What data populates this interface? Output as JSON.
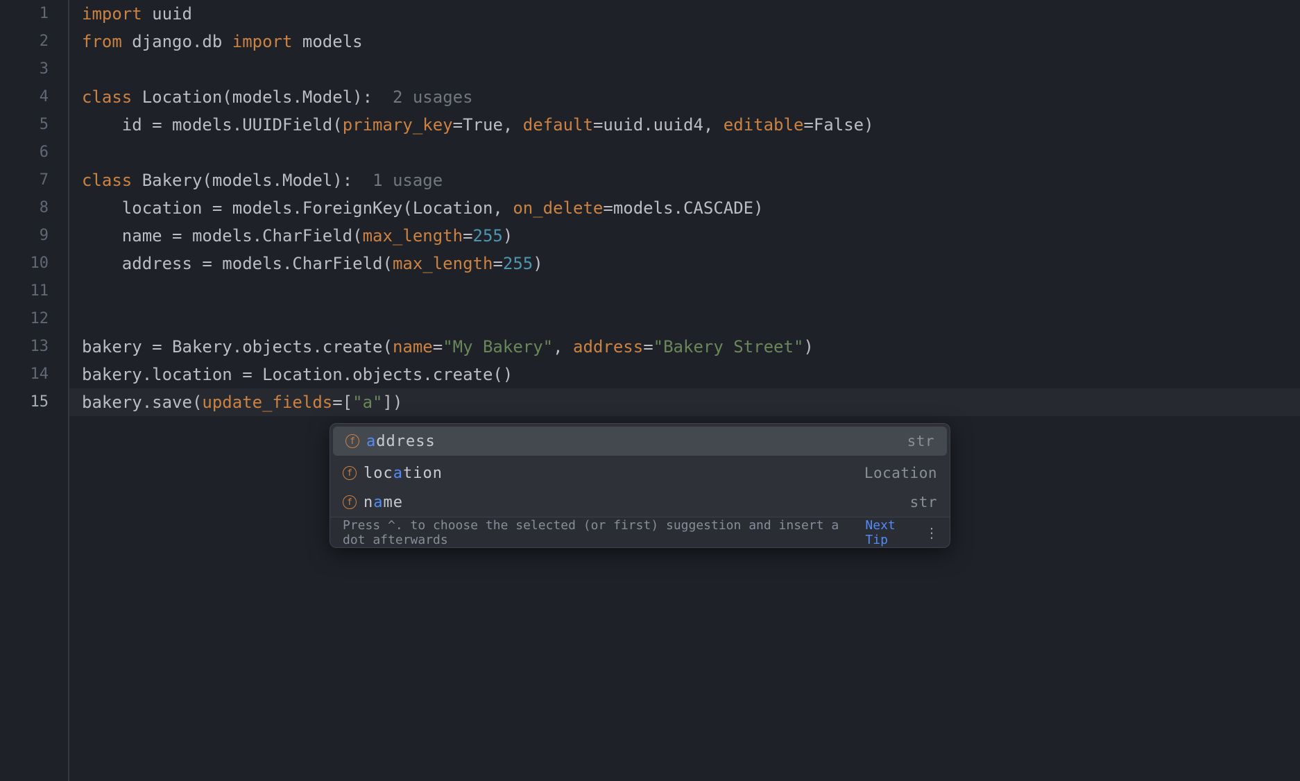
{
  "gutter": {
    "lines": [
      "1",
      "2",
      "3",
      "4",
      "5",
      "6",
      "7",
      "8",
      "9",
      "10",
      "11",
      "12",
      "13",
      "14",
      "15"
    ],
    "current": 15
  },
  "code": {
    "l1": {
      "kw1": "import",
      "mod": "uuid"
    },
    "l2": {
      "kw1": "from",
      "mod": "django.db",
      "kw2": "import",
      "name": "models"
    },
    "l4": {
      "kw": "class",
      "name": "Location",
      "base": "(models.Model):",
      "hint": "2 usages"
    },
    "l5": {
      "indent": "    ",
      "field": "id = models.UUIDField(",
      "p1": "primary_key",
      "v1": "=True, ",
      "p2": "default",
      "v2": "=uuid.uuid4, ",
      "p3": "editable",
      "v3": "=False)"
    },
    "l7": {
      "kw": "class",
      "name": "Bakery",
      "base": "(models.Model):",
      "hint": "1 usage"
    },
    "l8": {
      "indent": "    ",
      "field": "location = models.ForeignKey(Location, ",
      "p1": "on_delete",
      "v1": "=models.CASCADE)"
    },
    "l9": {
      "indent": "    ",
      "field": "name = models.CharField(",
      "p1": "max_length",
      "v1n": "=",
      "num": "255",
      "close": ")"
    },
    "l10": {
      "indent": "    ",
      "field": "address = models.CharField(",
      "p1": "max_length",
      "v1n": "=",
      "num": "255",
      "close": ")"
    },
    "l13": {
      "lhs": "bakery = Bakery.objects.create(",
      "p1": "name",
      "eq1": "=",
      "s1": "\"My Bakery\"",
      "sep": ", ",
      "p2": "address",
      "eq2": "=",
      "s2": "\"Bakery Street\"",
      "close": ")"
    },
    "l14": {
      "text": "bakery.location = Location.objects.create()"
    },
    "l15": {
      "lhs": "bakery.save(",
      "p1": "update_fields",
      "eq": "=[",
      "s1": "\"a\"",
      "close": "])"
    }
  },
  "completion": {
    "items": [
      {
        "icon": "f",
        "pre": "",
        "match": "a",
        "post": "ddress",
        "type": "str",
        "selected": true
      },
      {
        "icon": "f",
        "pre": "loc",
        "match": "a",
        "post": "tion",
        "type": "Location",
        "selected": false
      },
      {
        "icon": "f",
        "pre": "n",
        "match": "a",
        "post": "me",
        "type": "str",
        "selected": false
      }
    ],
    "footer_hint": "Press ^. to choose the selected (or first) suggestion and insert a dot afterwards",
    "next_tip": "Next Tip"
  }
}
